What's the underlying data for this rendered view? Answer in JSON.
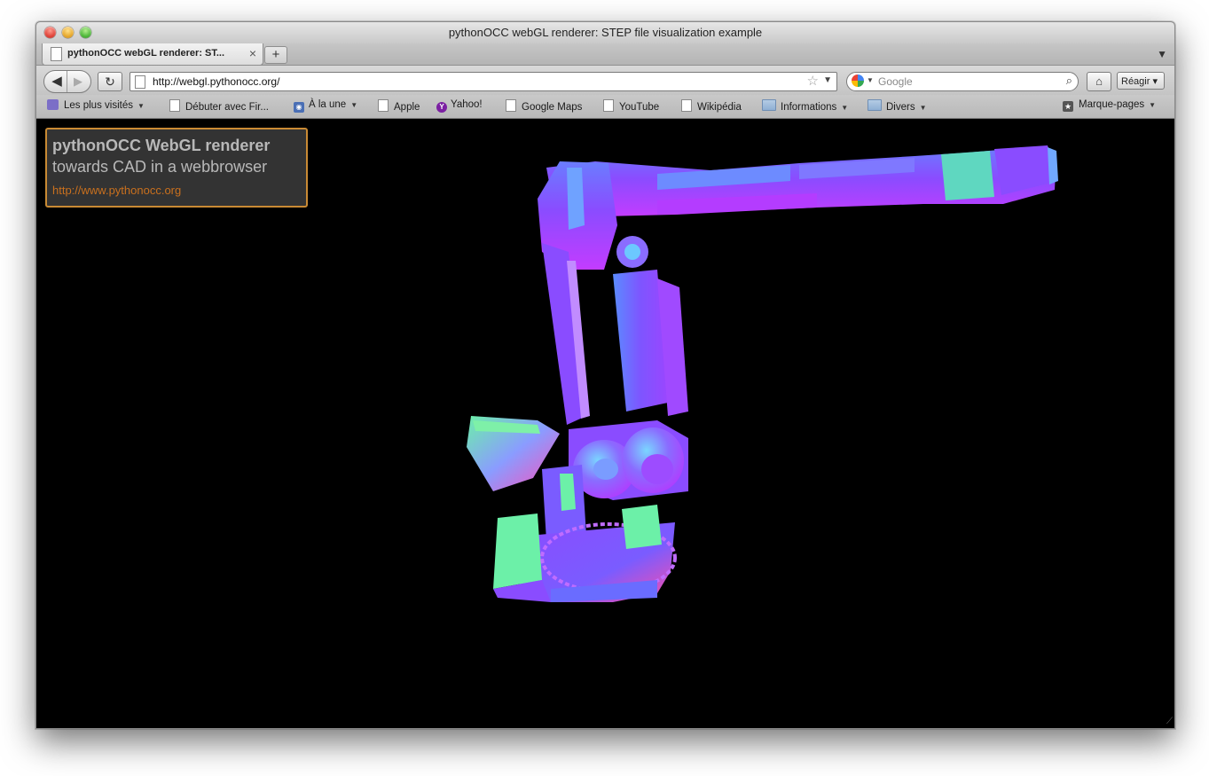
{
  "window": {
    "title": "pythonOCC webGL renderer: STEP file visualization example"
  },
  "tabs": [
    {
      "label": "pythonOCC webGL renderer: ST...",
      "active": true
    }
  ],
  "tab_controls": {
    "close": "×",
    "new_tab": "+",
    "list": "▼"
  },
  "nav": {
    "back": "◀",
    "forward": "▶",
    "reload": "↻",
    "url": "http://webgl.pythonocc.org/",
    "star": "☆",
    "url_dropdown": "▼",
    "search_placeholder": "Google",
    "home": "⌂",
    "reagir": "Réagir ▾"
  },
  "bookmarks": [
    {
      "label": "Les plus visités",
      "icon": "most-visited-icon",
      "dropdown": true
    },
    {
      "label": "Débuter avec Fir...",
      "icon": "page-icon",
      "dropdown": false
    },
    {
      "label": "À la une",
      "icon": "rss-icon",
      "dropdown": true
    },
    {
      "label": "Apple",
      "icon": "page-icon",
      "dropdown": false
    },
    {
      "label": "Yahoo!",
      "icon": "yahoo-icon",
      "dropdown": false
    },
    {
      "label": "Google Maps",
      "icon": "page-icon",
      "dropdown": false
    },
    {
      "label": "YouTube",
      "icon": "page-icon",
      "dropdown": false
    },
    {
      "label": "Wikipédia",
      "icon": "page-icon",
      "dropdown": false
    },
    {
      "label": "Informations",
      "icon": "folder-icon",
      "dropdown": true
    },
    {
      "label": "Divers",
      "icon": "folder-icon",
      "dropdown": true
    },
    {
      "label": "Marque-pages",
      "icon": "bookmarks-menu-icon",
      "dropdown": true
    }
  ],
  "info_box": {
    "title": "pythonOCC WebGL renderer",
    "subtitle": "towards CAD in a webbrowser",
    "link": "http://www.pythonocc.org"
  },
  "colors": {
    "background": "#000000",
    "info_border": "#c98a34",
    "info_link": "#c9701e",
    "model_purple": "#8a4cff",
    "model_green": "#6cf0a8",
    "model_pink": "#ff4ca8",
    "model_blue": "#6a6cff"
  }
}
